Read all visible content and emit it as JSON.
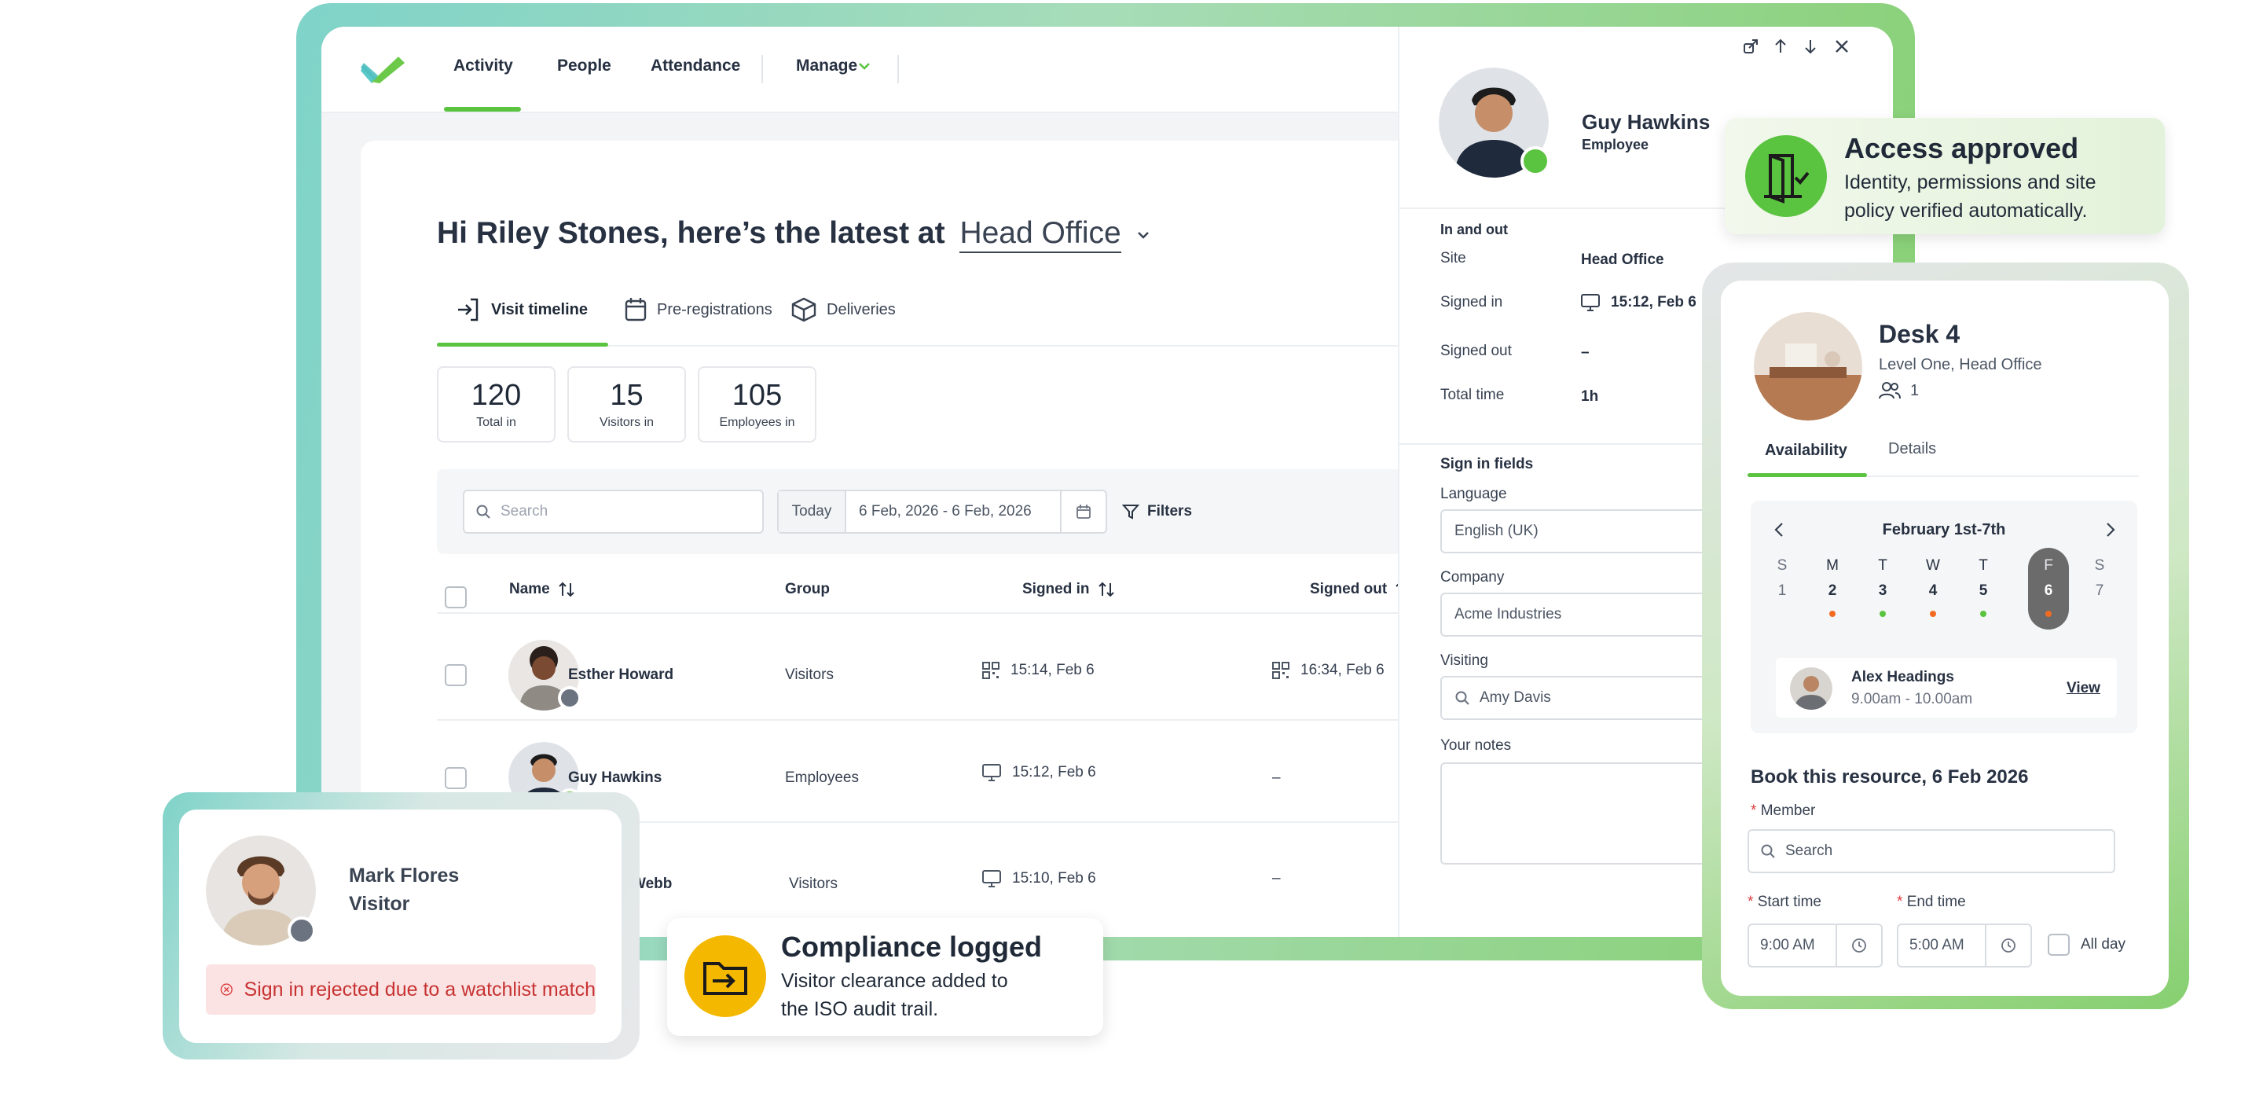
{
  "colors": {
    "brand_green": "#5ac33f",
    "danger": "#dc3b3b",
    "warning_yellow": "#f5b800",
    "muted_gray": "#6b7280"
  },
  "nav": {
    "logo": "check-logo",
    "items": [
      "Activity",
      "People",
      "Attendance",
      "Manage"
    ],
    "active": "Activity"
  },
  "main": {
    "greeting": "Hi Riley Stones, here’s the latest at",
    "site": "Head Office",
    "tabs": [
      {
        "label": "Visit timeline",
        "icon": "sign-in-icon"
      },
      {
        "label": "Pre-registrations",
        "icon": "calendar-icon"
      },
      {
        "label": "Deliveries",
        "icon": "box-icon"
      }
    ],
    "stats": [
      {
        "value": "120",
        "label": "Total in"
      },
      {
        "value": "15",
        "label": "Visitors in"
      },
      {
        "value": "105",
        "label": "Employees in"
      }
    ],
    "filters": {
      "search_placeholder": "Search",
      "today": "Today",
      "date_range": "6 Feb, 2026 - 6 Feb, 2026",
      "filters_label": "Filters"
    },
    "table": {
      "columns": [
        "Name",
        "Group",
        "Signed in",
        "Signed out"
      ],
      "rows": [
        {
          "name": "Esther Howard",
          "group": "Visitors",
          "signed_in": "15:14, Feb 6",
          "signed_out": "16:34, Feb 6",
          "in_method": "qr-code-icon",
          "out_method": "qr-code-icon",
          "status": "gray"
        },
        {
          "name": "Guy Hawkins",
          "group": "Employees",
          "signed_in": "15:12, Feb 6",
          "signed_out": "–",
          "in_method": "monitor-icon",
          "status": "green"
        },
        {
          "name": "Webb",
          "group": "Visitors",
          "signed_in": "15:10, Feb 6",
          "signed_out": "–",
          "in_method": "monitor-icon"
        }
      ]
    }
  },
  "panel": {
    "name": "Guy Hawkins",
    "role": "Employee",
    "section_inout": "In and out",
    "fields": [
      {
        "label": "Site",
        "value": "Head Office"
      },
      {
        "label": "Signed in",
        "value": "15:12, Feb 6"
      },
      {
        "label": "Signed out",
        "value": "–"
      },
      {
        "label": "Total time",
        "value": "1h"
      }
    ],
    "section_signin": "Sign in fields",
    "language_label": "Language",
    "language_value": "English (UK)",
    "company_label": "Company",
    "company_value": "Acme Industries",
    "visiting_label": "Visiting",
    "visiting_value": "Amy Davis",
    "notes_label": "Your notes"
  },
  "toast_access": {
    "title": "Access approved",
    "body": "Identity, permissions and site policy verified automatically.",
    "icon": "door-check-icon"
  },
  "toast_compliance": {
    "title": "Compliance logged",
    "body": "Visitor clearance added to the ISO audit trail.",
    "icon": "folder-arrow-icon"
  },
  "visitor_card": {
    "name": "Mark Flores",
    "role": "Visitor",
    "alert": "Sign in rejected due to a watchlist match"
  },
  "desk": {
    "title": "Desk 4",
    "location": "Level One, Head Office",
    "capacity": "1",
    "tabs": [
      "Availability",
      "Details"
    ],
    "week": "February 1st-7th",
    "days": [
      {
        "letter": "S",
        "num": "1",
        "dot": ""
      },
      {
        "letter": "M",
        "num": "2",
        "dot": "#f26b21"
      },
      {
        "letter": "T",
        "num": "3",
        "dot": "#5ac33f"
      },
      {
        "letter": "W",
        "num": "4",
        "dot": "#f26b21"
      },
      {
        "letter": "T",
        "num": "5",
        "dot": "#5ac33f"
      },
      {
        "letter": "F",
        "num": "6",
        "dot": "#f26b21"
      },
      {
        "letter": "S",
        "num": "7",
        "dot": ""
      }
    ],
    "selected_day": "6",
    "booking": {
      "name": "Alex Headings",
      "time": "9.00am - 10.00am",
      "action": "View"
    },
    "book_title": "Book this resource, 6 Feb 2026",
    "member_label": "Member",
    "member_placeholder": "Search",
    "start_label": "Start time",
    "start_value": "9:00 AM",
    "end_label": "End time",
    "end_value": "5:00 AM",
    "all_day": "All day"
  }
}
